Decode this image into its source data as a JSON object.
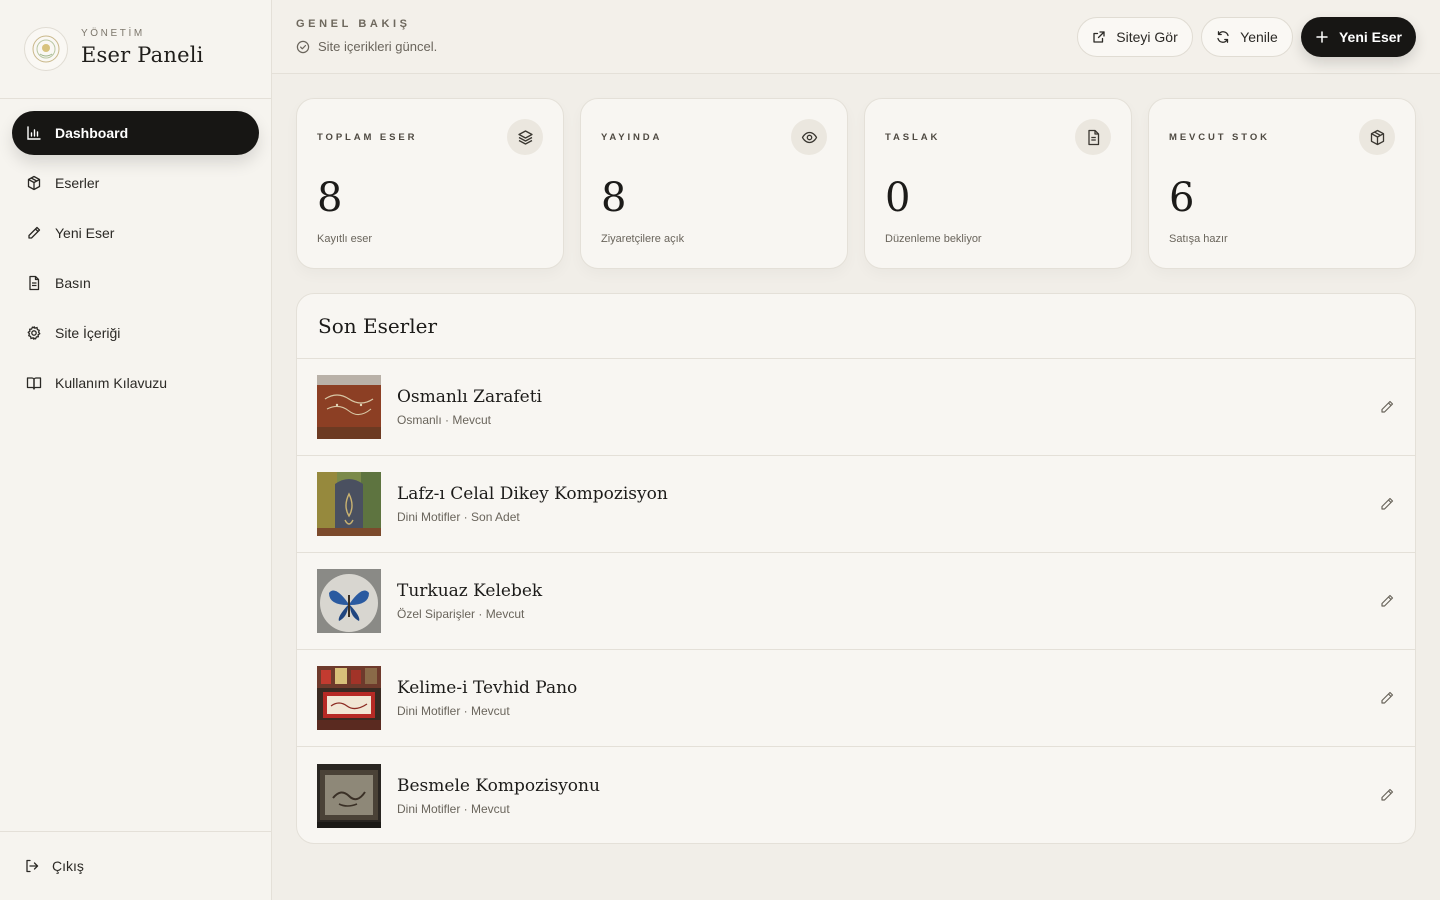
{
  "brand": {
    "kicker": "YÖNETİM",
    "title": "Eser Paneli"
  },
  "sidebar": {
    "items": [
      {
        "label": "Dashboard",
        "icon": "bar-chart-icon",
        "active": true
      },
      {
        "label": "Eserler",
        "icon": "box-icon"
      },
      {
        "label": "Yeni Eser",
        "icon": "pencil-icon"
      },
      {
        "label": "Basın",
        "icon": "document-icon"
      },
      {
        "label": "Site İçeriği",
        "icon": "gear-icon"
      },
      {
        "label": "Kullanım Kılavuzu",
        "icon": "book-icon"
      }
    ],
    "logout_label": "Çıkış"
  },
  "header": {
    "kicker": "GENEL BAKIŞ",
    "status": "Site içerikleri güncel.",
    "view_site_label": "Siteyi Gör",
    "refresh_label": "Yenile",
    "new_label": "Yeni Eser"
  },
  "stats": [
    {
      "label": "TOPLAM ESER",
      "value": "8",
      "sub": "Kayıtlı eser",
      "icon": "layers-icon"
    },
    {
      "label": "YAYINDA",
      "value": "8",
      "sub": "Ziyaretçilere açık",
      "icon": "eye-icon"
    },
    {
      "label": "TASLAK",
      "value": "0",
      "sub": "Düzenleme bekliyor",
      "icon": "document-icon"
    },
    {
      "label": "MEVCUT STOK",
      "value": "6",
      "sub": "Satışa hazır",
      "icon": "box-icon"
    }
  ],
  "recent": {
    "title": "Son Eserler",
    "rows": [
      {
        "title": "Osmanlı Zarafeti",
        "sub": "Osmanlı · Mevcut"
      },
      {
        "title": "Lafz-ı Celal Dikey Kompozisyon",
        "sub": "Dini Motifler · Son Adet"
      },
      {
        "title": "Turkuaz Kelebek",
        "sub": "Özel Siparişler · Mevcut"
      },
      {
        "title": "Kelime-i Tevhid Pano",
        "sub": "Dini Motifler · Mevcut"
      },
      {
        "title": "Besmele Kompozisyonu",
        "sub": "Dini Motifler · Mevcut"
      }
    ]
  },
  "colors": {
    "accent_dark": "#171614",
    "background": "#f1eee8",
    "surface": "#f8f6f2"
  }
}
